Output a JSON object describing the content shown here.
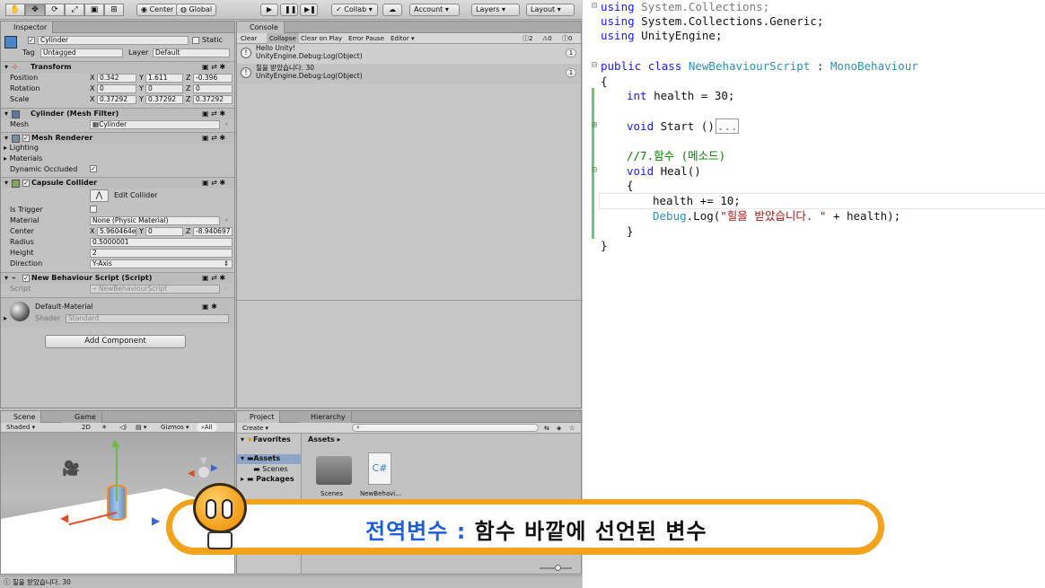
{
  "toolbar": {
    "tools": [
      "hand",
      "move",
      "rotate",
      "scale",
      "rect",
      "transform"
    ],
    "pivot": "Center",
    "space": "Global",
    "collab": "Collab",
    "account": "Account",
    "layers": "Layers",
    "layout": "Layout"
  },
  "inspector": {
    "tab": "Inspector",
    "object_name": "Cylinder",
    "static_label": "Static",
    "tag_label": "Tag",
    "tag_value": "Untagged",
    "layer_label": "Layer",
    "layer_value": "Default",
    "transform": {
      "title": "Transform",
      "position_label": "Position",
      "position": [
        "0.342",
        "1.611",
        "-0.396"
      ],
      "rotation_label": "Rotation",
      "rotation": [
        "0",
        "0",
        "0"
      ],
      "scale_label": "Scale",
      "scale": [
        "0.37292",
        "0.37292",
        "0.37292"
      ],
      "x": "X",
      "y": "Y",
      "z": "Z"
    },
    "mesh_filter": {
      "title": "Cylinder (Mesh Filter)",
      "mesh_label": "Mesh",
      "mesh_value": "Cylinder"
    },
    "mesh_renderer": {
      "title": "Mesh Renderer",
      "lighting": "Lighting",
      "materials": "Materials",
      "dynamic_occluded": "Dynamic Occluded"
    },
    "capsule_collider": {
      "title": "Capsule Collider",
      "edit_collider": "Edit Collider",
      "is_trigger": "Is Trigger",
      "material_label": "Material",
      "material_value": "None (Physic Material)",
      "center_label": "Center",
      "center": [
        "5.960464e",
        "0",
        "-8.940697"
      ],
      "radius_label": "Radius",
      "radius": "0.5000001",
      "height_label": "Height",
      "height": "2",
      "direction_label": "Direction",
      "direction": "Y-Axis"
    },
    "script": {
      "title": "New Behaviour Script (Script)",
      "script_label": "Script",
      "script_value": "NewBehaviourScript"
    },
    "material": {
      "name": "Default-Material",
      "shader_label": "Shader",
      "shader_value": "Standard"
    },
    "add_component": "Add Component"
  },
  "console": {
    "tab": "Console",
    "buttons": [
      "Clear",
      "Collapse",
      "Clear on Play",
      "Error Pause",
      "Editor"
    ],
    "counts": [
      "2",
      "0",
      "0"
    ],
    "messages": [
      {
        "line1": "Hello Unity!",
        "line2": "UnityEngine.Debug:Log(Object)",
        "count": "1"
      },
      {
        "line1": "힐을 받았습니다. 30",
        "line2": "UnityEngine.Debug:Log(Object)",
        "count": "1"
      }
    ]
  },
  "scene": {
    "tab_scene": "Scene",
    "tab_game": "Game",
    "shading": "Shaded",
    "mode_2d": "2D",
    "gizmos": "Gizmos",
    "all": "All"
  },
  "project": {
    "tab_project": "Project",
    "tab_hierarchy": "Hierarchy",
    "create": "Create",
    "favorites": "Favorites",
    "assets": "Assets",
    "scenes": "Scenes",
    "packages": "Packages",
    "breadcrumb": "Assets",
    "items": [
      "Scenes",
      "NewBehavi..."
    ],
    "cs_icon": "C#"
  },
  "status_bar": "힐을 받았습니다. 30",
  "banner": {
    "keyword": "전역변수",
    "colon": ":",
    "definition": "함수 바깥에 선언된 변수",
    "keyword_color": "#1f5fd6",
    "border_color": "#f3a21b"
  },
  "code": {
    "l1a": "using",
    "l1b": " System.Collections;",
    "l2a": "using",
    "l2b": " System.Collections.Generic;",
    "l3a": "using",
    "l3b": " UnityEngine;",
    "l5a": "public",
    "l5b": "class",
    "l5c": "NewBehaviourScript",
    "l5d": " : ",
    "l5e": "MonoBehaviour",
    "l6": "{",
    "l7a": "int",
    "l7b": " health = 30;",
    "l9a": "void",
    "l9b": " Start ()",
    "l9c": "...",
    "l11": "//7.함수 (메소드)",
    "l12a": "void",
    "l12b": " Heal()",
    "l13": "{",
    "l14": "health += 10;",
    "l15a": "Debug",
    "l15b": ".Log(",
    "l15c": "\"힐을 받았습니다. \"",
    "l15d": " + health);",
    "l16": "}",
    "l17": "}"
  }
}
